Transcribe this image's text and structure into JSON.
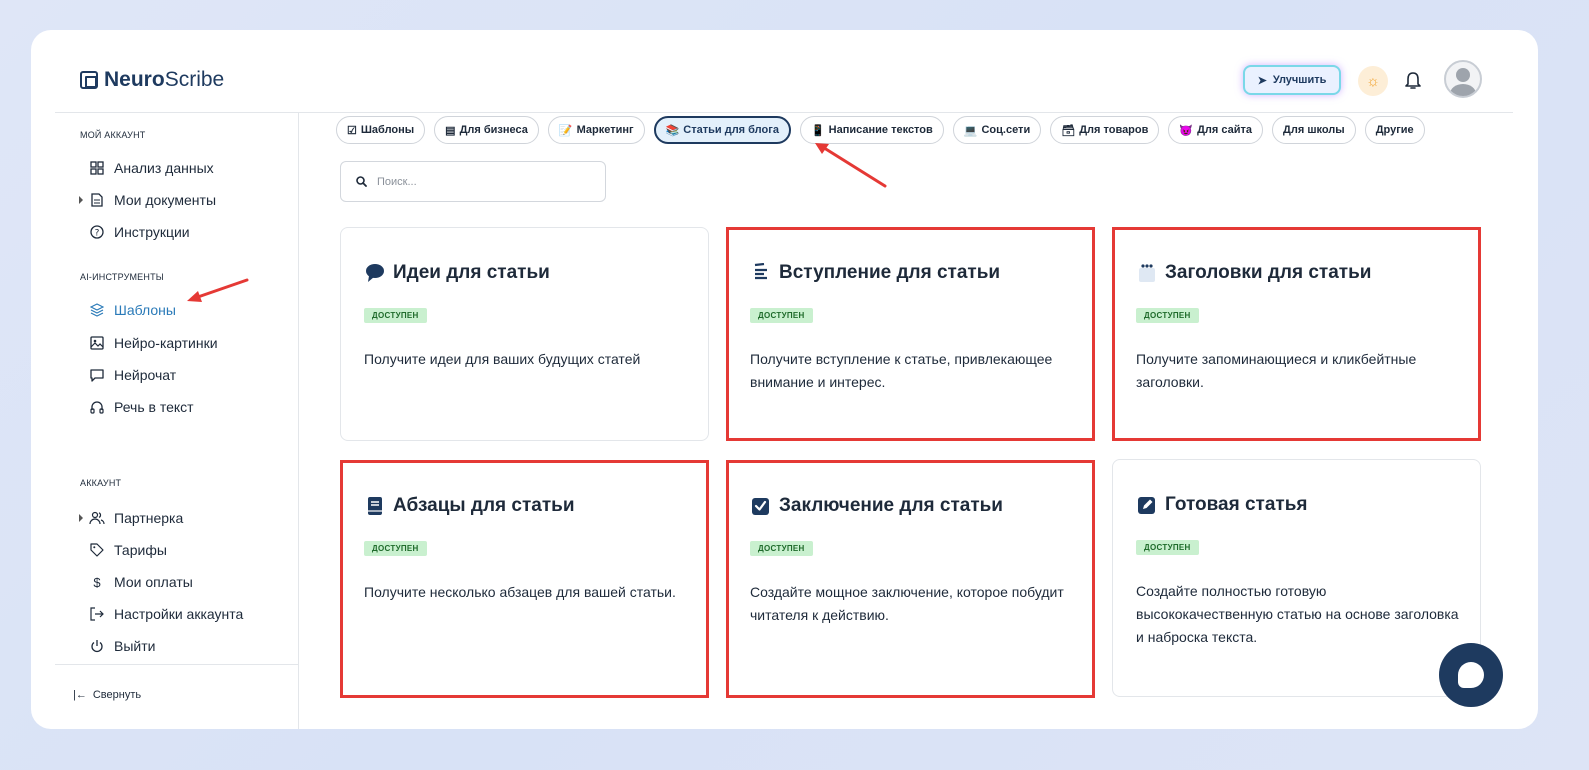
{
  "app": {
    "logo_bold": "Neuro",
    "logo_rest": "Scribe"
  },
  "header": {
    "upgrade_label": "Улучшить"
  },
  "sidebar": {
    "sections": {
      "account": "МОЙ АККАУНТ",
      "ai_tools": "AI-ИНСТРУМЕНТЫ",
      "account2": "АККАУНТ"
    },
    "items": [
      {
        "label": "Анализ данных",
        "icon": "grid-icon"
      },
      {
        "label": "Мои документы",
        "icon": "document-icon"
      },
      {
        "label": "Инструкции",
        "icon": "help-circle-icon"
      },
      {
        "label": "Шаблоны",
        "icon": "layers-icon",
        "active": true
      },
      {
        "label": "Нейро-картинки",
        "icon": "image-icon"
      },
      {
        "label": "Нейрочат",
        "icon": "chat-icon"
      },
      {
        "label": "Речь в текст",
        "icon": "headphones-icon"
      },
      {
        "label": "Партнерка",
        "icon": "users-icon"
      },
      {
        "label": "Тарифы",
        "icon": "tag-icon"
      },
      {
        "label": "Мои оплаты",
        "icon": "dollar-icon"
      },
      {
        "label": "Настройки аккаунта",
        "icon": "login-icon"
      },
      {
        "label": "Выйти",
        "icon": "power-icon"
      }
    ],
    "collapse_label": "Свернуть"
  },
  "categories": [
    {
      "label": "Шаблоны",
      "icon": "☑"
    },
    {
      "label": "Для бизнеса",
      "icon": "▤"
    },
    {
      "label": "Маркетинг",
      "icon": "📝"
    },
    {
      "label": "Статьи для блога",
      "icon": "📚",
      "active": true
    },
    {
      "label": "Написание текстов",
      "icon": "📱"
    },
    {
      "label": "Соц.сети",
      "icon": "💻"
    },
    {
      "label": "Для товаров",
      "icon": "🗃"
    },
    {
      "label": "Для сайта",
      "icon": "😈"
    },
    {
      "label": "Для школы",
      "icon": ""
    },
    {
      "label": "Другие",
      "icon": ""
    }
  ],
  "search": {
    "placeholder": "Поиск..."
  },
  "cards": [
    {
      "title": "Идеи для статьи",
      "badge": "ДОСТУПЕН",
      "desc": "Получите идеи для ваших будущих статей",
      "icon": "speech-bubble-icon",
      "highlighted": false
    },
    {
      "title": "Вступление для статьи",
      "badge": "ДОСТУПЕН",
      "desc": "Получите вступление к статье, привлекающее внимание и интерес.",
      "icon": "text-lines-icon",
      "highlighted": true
    },
    {
      "title": "Заголовки для статьи",
      "badge": "ДОСТУПЕН",
      "desc": "Получите запоминающиеся и кликбейтные заголовки.",
      "icon": "notepad-icon",
      "highlighted": true
    },
    {
      "title": "Абзацы для статьи",
      "badge": "ДОСТУПЕН",
      "desc": "Получите несколько абзацев для вашей статьи.",
      "icon": "book-icon",
      "highlighted": true
    },
    {
      "title": "Заключение для статьи",
      "badge": "ДОСТУПЕН",
      "desc": "Создайте мощное заключение, которое побудит читателя к действию.",
      "icon": "checkbox-icon",
      "highlighted": true
    },
    {
      "title": "Готовая статья",
      "badge": "ДОСТУПЕН",
      "desc": "Создайте полностью готовую высококачественную статью на основе заголовка и наброска текста.",
      "icon": "edit-icon",
      "highlighted": false
    }
  ],
  "colors": {
    "accent": "#2a7ab8",
    "highlight": "#e53935",
    "badge_bg": "#c9f0cf",
    "navy": "#1e3a5f"
  }
}
